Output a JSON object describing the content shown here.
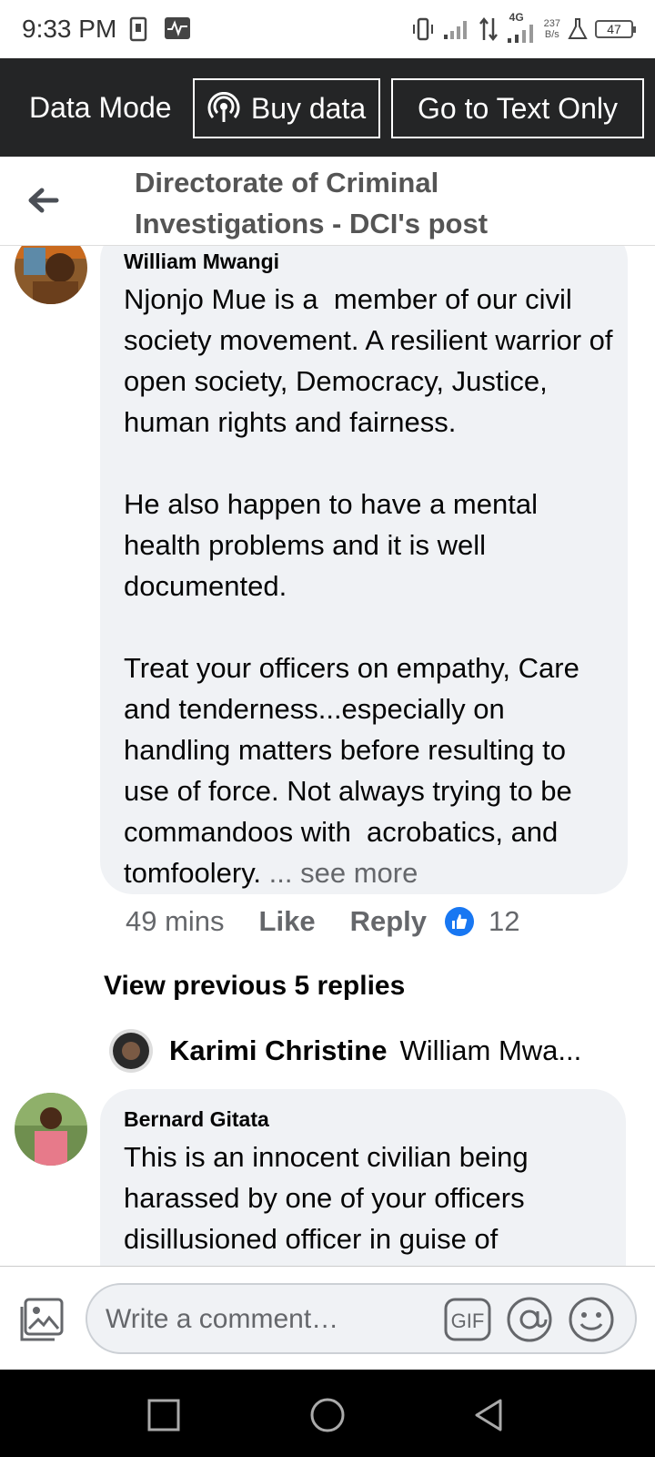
{
  "status_bar": {
    "time": "9:33 PM",
    "net_speed_value": "237",
    "net_speed_unit": "B/s",
    "network_type": "4G",
    "battery": "47"
  },
  "data_bar": {
    "mode_label": "Data Mode",
    "buy_data_label": "Buy data",
    "text_only_label": "Go to Text Only"
  },
  "header": {
    "title": "Directorate of Criminal Investigations - DCI's post"
  },
  "comments": [
    {
      "author": "William Mwangi",
      "text": "Njonjo Mue is a  member of our civil society movement. A resilient warrior of open society, Democracy, Justice, human rights and fairness.\n\nHe also happen to have a mental health problems and it is well documented.\n\nTreat your officers on empathy, Care and tenderness...especially on handling matters before resulting to use of force. Not always trying to be  commandoos with  acrobatics, and tomfoolery.",
      "see_more": " ... see more",
      "time": "49 mins",
      "like_label": "Like",
      "reply_label": "Reply",
      "like_count": "12"
    },
    {
      "author": "Bernard Gitata",
      "text": "This is an innocent civilian being harassed by one of your officers disillusioned officer in guise of"
    }
  ],
  "replies": {
    "view_previous": "View previous 5 replies",
    "preview_author": "Karimi Christine",
    "preview_text": "William Mwa..."
  },
  "composer": {
    "placeholder": "Write a comment…",
    "gif_label": "GIF"
  },
  "colors": {
    "data_bar_bg": "#242526",
    "bubble_bg": "#f0f2f5",
    "like_blue": "#1877f2",
    "secondary_text": "#65676b"
  }
}
